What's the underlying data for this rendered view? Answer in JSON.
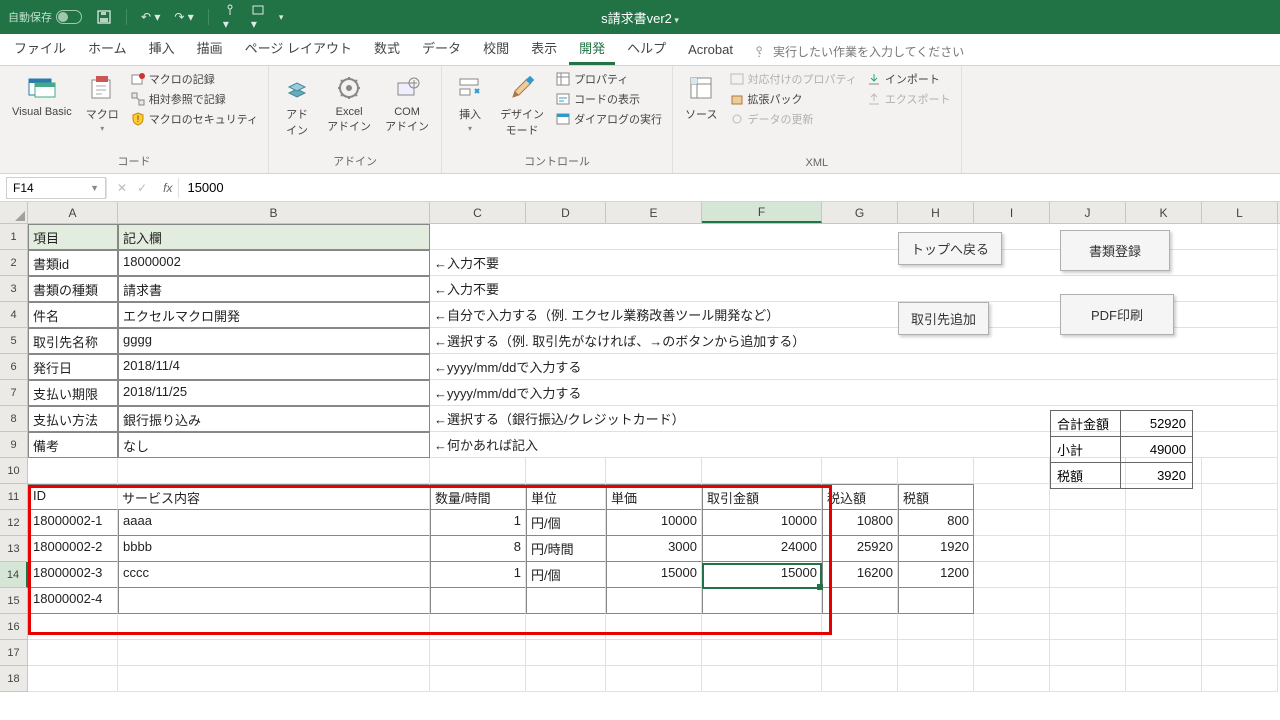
{
  "titlebar": {
    "autosave": "自動保存",
    "filename": "s請求書ver2"
  },
  "tabs": [
    "ファイル",
    "ホーム",
    "挿入",
    "描画",
    "ページ レイアウト",
    "数式",
    "データ",
    "校閲",
    "表示",
    "開発",
    "ヘルプ",
    "Acrobat"
  ],
  "tell": "実行したい作業を入力してください",
  "ribbon": {
    "code": {
      "vb": "Visual Basic",
      "macro": "マクロ",
      "rec": "マクロの記録",
      "rel": "相対参照で記録",
      "sec": "マクロのセキュリティ",
      "label": "コード"
    },
    "addin": {
      "a1": "アド\nイン",
      "a2": "Excel\nアドイン",
      "a3": "COM\nアドイン",
      "label": "アドイン"
    },
    "ctrl": {
      "ins": "挿入",
      "dm": "デザイン\nモード",
      "prop": "プロパティ",
      "code": "コードの表示",
      "dlg": "ダイアログの実行",
      "label": "コントロール"
    },
    "xml": {
      "src": "ソース",
      "map": "対応付けのプロパティ",
      "exp": "拡張パック",
      "ref": "データの更新",
      "imp": "インポート",
      "out": "エクスポート",
      "label": "XML"
    }
  },
  "fbar": {
    "ref": "F14",
    "val": "15000"
  },
  "cols": [
    "A",
    "B",
    "C",
    "D",
    "E",
    "F",
    "G",
    "H",
    "I",
    "J",
    "K",
    "L"
  ],
  "header": {
    "r1": {
      "a": "項目",
      "b": "記入欄"
    },
    "r2": {
      "a": "書類id",
      "b": "18000002",
      "c": "←入力不要"
    },
    "r3": {
      "a": "書類の種類",
      "b": "請求書",
      "c": "←入力不要"
    },
    "r4": {
      "a": "件名",
      "b": "エクセルマクロ開発",
      "c": "←自分で入力する（例. エクセル業務改善ツール開発など）"
    },
    "r5": {
      "a": "取引先名称",
      "b": "gggg",
      "c": "←選択する（例. 取引先がなければ、→のボタンから追加する）"
    },
    "r6": {
      "a": "発行日",
      "b": "2018/11/4",
      "c": "←yyyy/mm/ddで入力する"
    },
    "r7": {
      "a": "支払い期限",
      "b": "2018/11/25",
      "c": "←yyyy/mm/ddで入力する"
    },
    "r8": {
      "a": "支払い方法",
      "b": "銀行振り込み",
      "c": "←選択する（銀行振込/クレジットカード）"
    },
    "r9": {
      "a": "備考",
      "b": "なし",
      "c": "←何かあれば記入"
    }
  },
  "thead": {
    "id": "ID",
    "svc": "サービス内容",
    "qty": "数量/時間",
    "unit": "単位",
    "price": "単価",
    "amt": "取引金額",
    "tax": "税込額",
    "taxamt": "税額"
  },
  "trows": [
    {
      "id": "18000002-1",
      "svc": "aaaa",
      "qty": "1",
      "unit": "円/個",
      "price": "10000",
      "amt": "10000",
      "tax": "10800",
      "taxamt": "800"
    },
    {
      "id": "18000002-2",
      "svc": "bbbb",
      "qty": "8",
      "unit": "円/時間",
      "price": "3000",
      "amt": "24000",
      "tax": "25920",
      "taxamt": "1920"
    },
    {
      "id": "18000002-3",
      "svc": "cccc",
      "qty": "1",
      "unit": "円/個",
      "price": "15000",
      "amt": "15000",
      "tax": "16200",
      "taxamt": "1200"
    },
    {
      "id": "18000002-4",
      "svc": "",
      "qty": "",
      "unit": "",
      "price": "",
      "amt": "",
      "tax": "",
      "taxamt": ""
    }
  ],
  "summary": {
    "l1": "合計金額",
    "v1": "52920",
    "l2": "小計",
    "v2": "49000",
    "l3": "税額",
    "v3": "3920"
  },
  "btns": {
    "top": "トップへ戻る",
    "reg": "書類登録",
    "add": "取引先追加",
    "pdf": "PDF印刷"
  }
}
